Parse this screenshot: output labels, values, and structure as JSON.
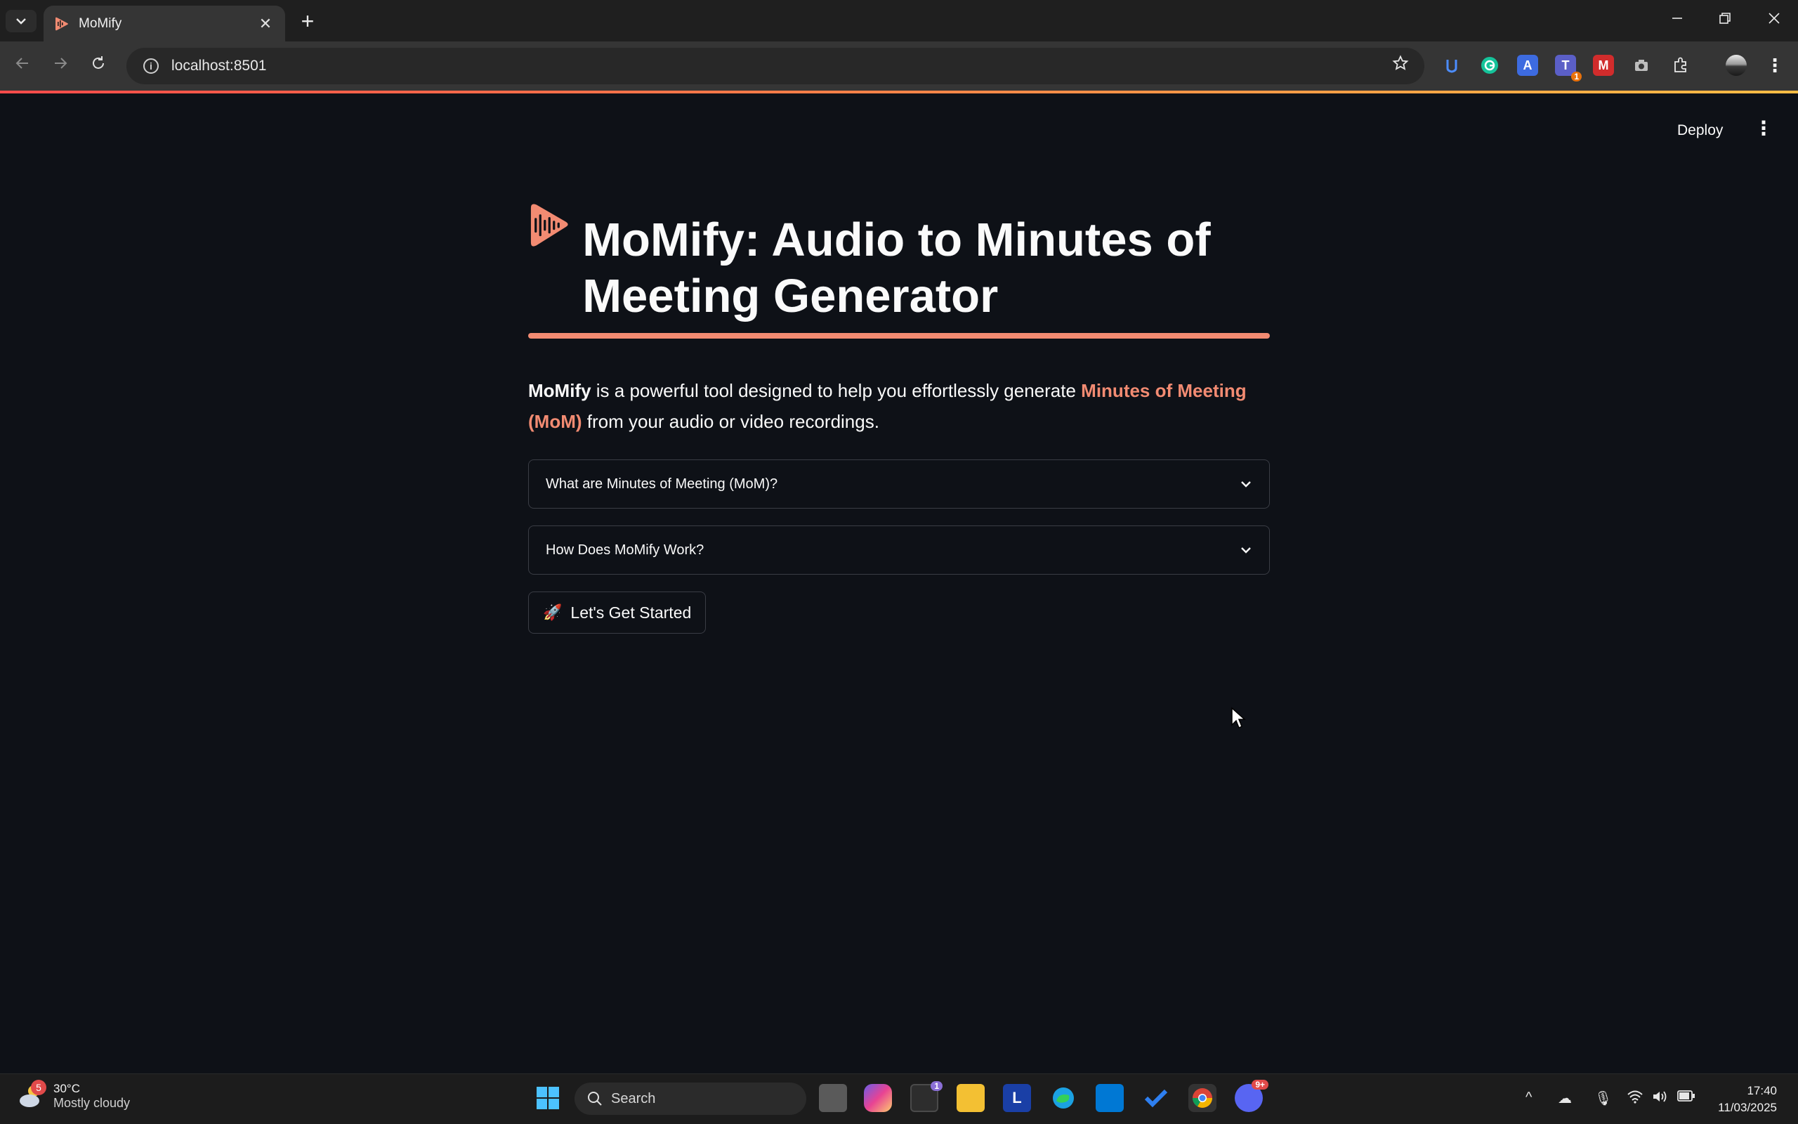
{
  "browser": {
    "tab_title": "MoMify",
    "url": "localhost:8501",
    "new_tab_symbol": "+",
    "close_symbol": "✕"
  },
  "app_header": {
    "deploy_label": "Deploy"
  },
  "page": {
    "title": "MoMify: Audio to Minutes of Meeting Generator",
    "intro_bold": "MoMify",
    "intro_text_1": " is a powerful tool designed to help you effortlessly generate ",
    "intro_highlight": "Minutes of Meeting (MoM)",
    "intro_text_2": " from your audio or video recordings.",
    "accent_color": "#f28b72",
    "expanders": [
      {
        "label": "What are Minutes of Meeting (MoM)?"
      },
      {
        "label": "How Does MoMify Work?"
      }
    ],
    "start_button": {
      "icon": "🚀",
      "label": "Let's Get Started"
    }
  },
  "taskbar": {
    "weather_badge": "5",
    "weather_temp": "30°C",
    "weather_desc": "Mostly cloudy",
    "search_label": "Search",
    "store_badge": "1",
    "discord_badge": "9+",
    "time": "17:40",
    "date": "11/03/2025"
  },
  "extensions": {
    "teams_badge": "1"
  }
}
